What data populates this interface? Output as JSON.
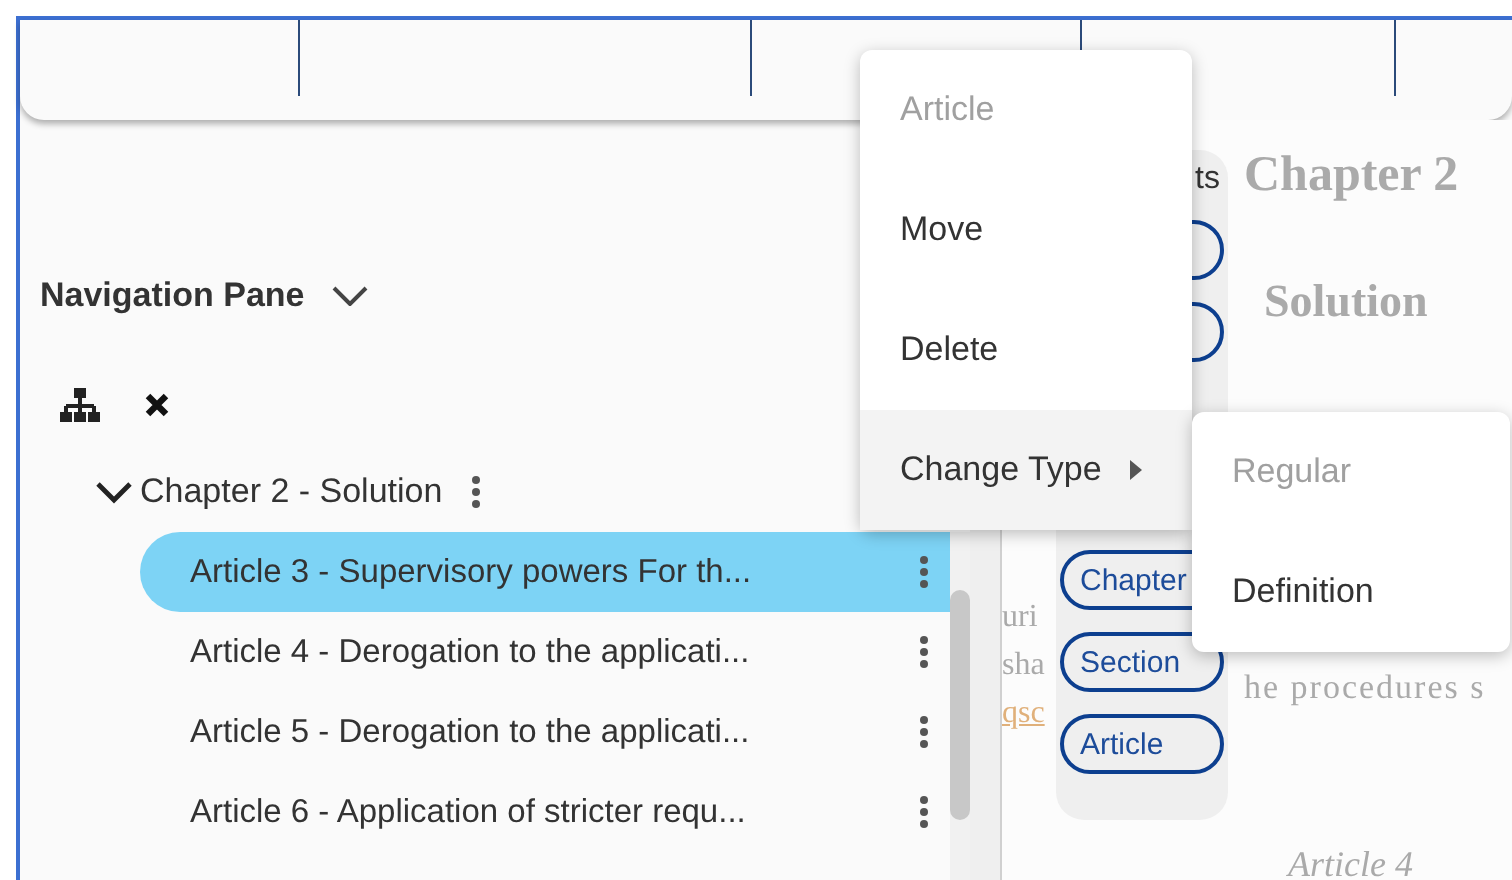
{
  "navigation_pane": {
    "title": "Navigation Pane",
    "tree": [
      {
        "label": "Chapter 2 - Solution",
        "expanded": true,
        "children": [
          {
            "label": "Article 3 - Supervisory powers For th...",
            "selected": true
          },
          {
            "label": "Article 4 - Derogation to the applicati...",
            "selected": false
          },
          {
            "label": "Article 5 - Derogation to the applicati...",
            "selected": false
          },
          {
            "label": "Article 6 - Application of stricter requ...",
            "selected": false
          }
        ]
      }
    ]
  },
  "elements_palette": {
    "title": "ts",
    "chips": [
      "Chapter",
      "Section",
      "Article"
    ]
  },
  "document": {
    "heading": "Chapter 2",
    "subheading": "Solution",
    "fragments": [
      {
        "text": "uri",
        "kind": "plain"
      },
      {
        "text": "sha",
        "kind": "plain"
      },
      {
        "text": "qsc",
        "kind": "link"
      }
    ],
    "text": "he procedures s",
    "next_heading": "Article 4"
  },
  "context_menu": {
    "items": [
      {
        "label": "Article",
        "disabled": true,
        "highlighted": false,
        "has_submenu": false
      },
      {
        "label": "Move",
        "disabled": false,
        "highlighted": false,
        "has_submenu": false
      },
      {
        "label": "Delete",
        "disabled": false,
        "highlighted": false,
        "has_submenu": false
      },
      {
        "label": "Change Type",
        "disabled": false,
        "highlighted": true,
        "has_submenu": true
      }
    ]
  },
  "submenu": {
    "items": [
      {
        "label": "Regular",
        "disabled": true
      },
      {
        "label": "Definition",
        "disabled": false
      }
    ]
  }
}
